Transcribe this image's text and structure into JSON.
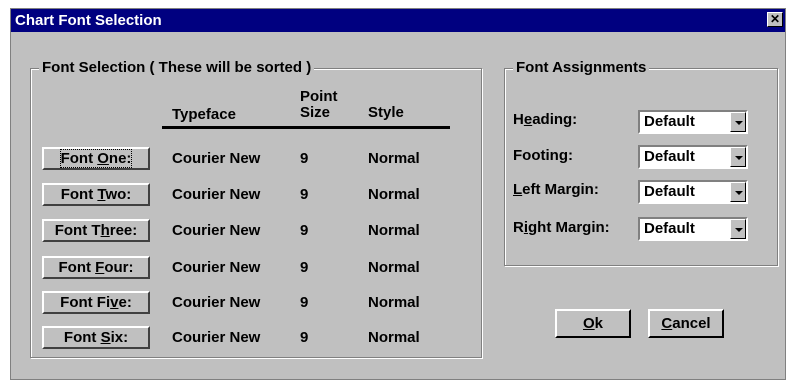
{
  "window": {
    "title": "Chart Font Selection",
    "close_glyph": "✕"
  },
  "font_selection": {
    "legend": "Font Selection ( These will be sorted )",
    "headers": {
      "typeface": "Typeface",
      "point_size_1": "Point",
      "point_size_2": "Size",
      "style": "Style"
    },
    "rows": [
      {
        "button_pre": "Font ",
        "button_mn": "O",
        "button_post": "ne:",
        "typeface": "Courier New",
        "size": "9",
        "style": "Normal"
      },
      {
        "button_pre": "Font ",
        "button_mn": "T",
        "button_post": "wo:",
        "typeface": "Courier New",
        "size": "9",
        "style": "Normal"
      },
      {
        "button_pre": "Font T",
        "button_mn": "h",
        "button_post": "ree:",
        "typeface": "Courier New",
        "size": "9",
        "style": "Normal"
      },
      {
        "button_pre": "Font ",
        "button_mn": "F",
        "button_post": "our:",
        "typeface": "Courier New",
        "size": "9",
        "style": "Normal"
      },
      {
        "button_pre": "Font Fi",
        "button_mn": "v",
        "button_post": "e:",
        "typeface": "Courier New",
        "size": "9",
        "style": "Normal"
      },
      {
        "button_pre": "Font ",
        "button_mn": "S",
        "button_post": "ix:",
        "typeface": "Courier New",
        "size": "9",
        "style": "Normal"
      }
    ]
  },
  "font_assignments": {
    "legend": "Font Assignments",
    "items": [
      {
        "label_pre": "H",
        "label_mn": "e",
        "label_post": "ading:",
        "value": "Default"
      },
      {
        "label_pre": "",
        "label_mn": "",
        "label_post": "Footing:",
        "value": "Default"
      },
      {
        "label_pre": "",
        "label_mn": "L",
        "label_post": "eft Margin:",
        "value": "Default"
      },
      {
        "label_pre": "R",
        "label_mn": "i",
        "label_post": "ght Margin:",
        "value": "Default"
      }
    ]
  },
  "buttons": {
    "ok": {
      "mn": "O",
      "post": "k"
    },
    "cancel": {
      "mn": "C",
      "post": "ancel"
    }
  }
}
